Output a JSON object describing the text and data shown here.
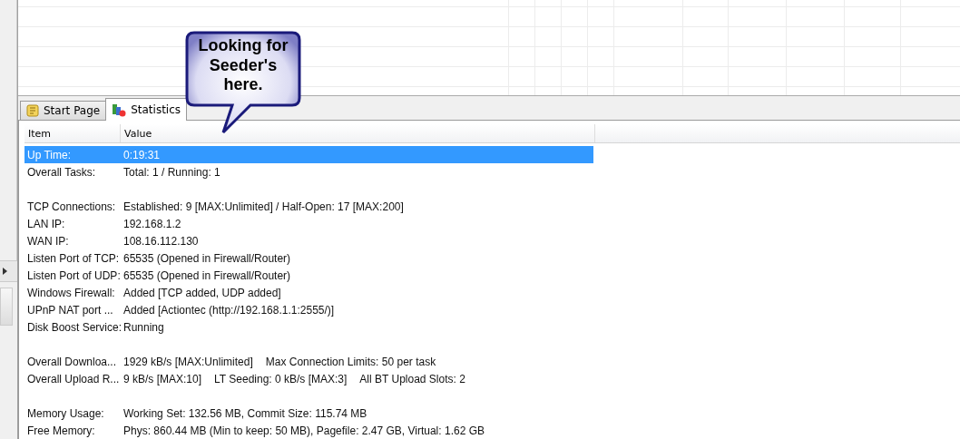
{
  "callout": {
    "text": "Looking for Seeder's here."
  },
  "tabs": [
    {
      "label": "Start Page",
      "kind": "page",
      "selected": false
    },
    {
      "label": "Statistics",
      "kind": "stats",
      "selected": true
    }
  ],
  "table": {
    "columns": [
      "Item",
      "Value"
    ],
    "rows": [
      {
        "kind": "row",
        "item": "Up Time:",
        "values": [
          "0:19:31"
        ],
        "selected": true
      },
      {
        "kind": "row",
        "item": "Overall Tasks:",
        "values": [
          "Total: 1 / Running: 1"
        ],
        "selected": false
      },
      {
        "kind": "blank"
      },
      {
        "kind": "row",
        "item": "TCP Connections:",
        "values": [
          "Established: 9 [MAX:Unlimited] / Half-Open: 17 [MAX:200]"
        ],
        "selected": false
      },
      {
        "kind": "row",
        "item": "LAN IP:",
        "values": [
          "192.168.1.2"
        ],
        "selected": false
      },
      {
        "kind": "row",
        "item": "WAN IP:",
        "values": [
          "108.16.112.130"
        ],
        "selected": false
      },
      {
        "kind": "row",
        "item": "Listen Port of TCP:",
        "values": [
          "65535 (Opened in Firewall/Router)"
        ],
        "selected": false
      },
      {
        "kind": "row",
        "item": "Listen Port of UDP:",
        "values": [
          "65535 (Opened in Firewall/Router)"
        ],
        "selected": false
      },
      {
        "kind": "row",
        "item": "Windows Firewall:",
        "values": [
          "Added [TCP added, UDP added]"
        ],
        "selected": false
      },
      {
        "kind": "row",
        "item": "UPnP NAT port ...",
        "values": [
          "Added [Actiontec (http://192.168.1.1:2555/)]"
        ],
        "selected": false
      },
      {
        "kind": "row",
        "item": "Disk Boost Service:",
        "values": [
          "Running"
        ],
        "selected": false
      },
      {
        "kind": "blank"
      },
      {
        "kind": "row",
        "item": "Overall Downloa...",
        "values": [
          "1929 kB/s [MAX:Unlimited]",
          "Max Connection Limits: 50 per task"
        ],
        "selected": false
      },
      {
        "kind": "row",
        "item": "Overall Upload R...",
        "values": [
          "9 kB/s [MAX:10]",
          "LT Seeding: 0 kB/s [MAX:3]",
          "All BT Upload Slots: 2"
        ],
        "selected": false
      },
      {
        "kind": "blank"
      },
      {
        "kind": "row",
        "item": "Memory Usage:",
        "values": [
          "Working Set: 132.56 MB, Commit Size: 115.74 MB"
        ],
        "selected": false
      },
      {
        "kind": "row",
        "item": "Free Memory:",
        "values": [
          "Phys: 860.44 MB (Min to keep: 50 MB), Pagefile: 2.47 GB, Virtual: 1.62 GB"
        ],
        "selected": false
      }
    ]
  }
}
